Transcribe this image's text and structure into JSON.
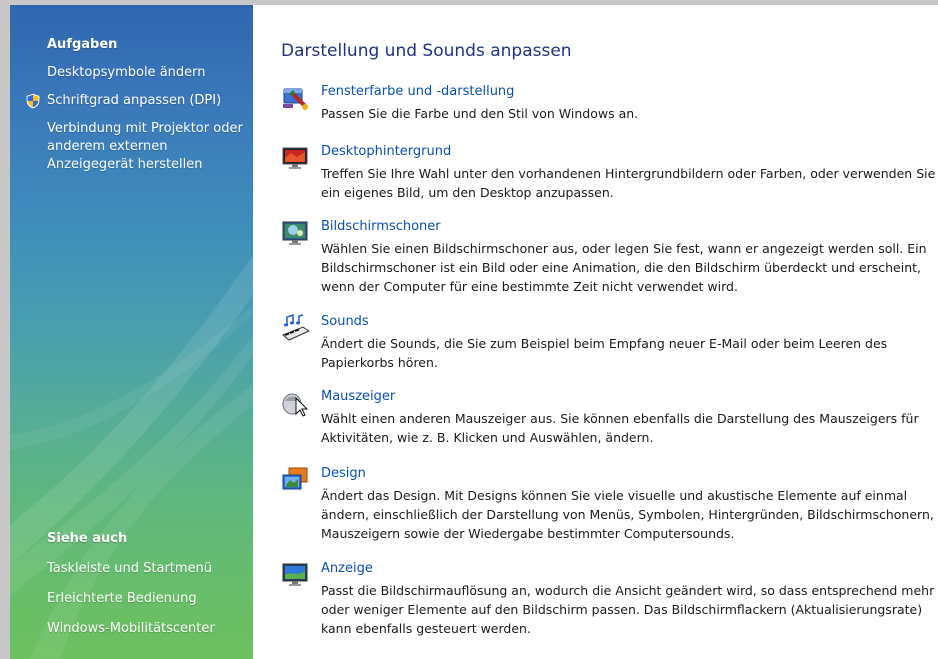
{
  "sidebar": {
    "tasks_heading": "Aufgaben",
    "tasks": [
      {
        "label": "Desktopsymbole ändern",
        "icon": null
      },
      {
        "label": "Schriftgrad anpassen (DPI)",
        "icon": "shield-icon"
      },
      {
        "label": "Verbindung mit Projektor oder anderem externen Anzeigegerät herstellen",
        "icon": null
      }
    ],
    "see_also_heading": "Siehe auch",
    "see_also": [
      {
        "label": "Taskleiste und Startmenü"
      },
      {
        "label": "Erleichterte Bedienung"
      },
      {
        "label": "Windows-Mobilitätscenter"
      }
    ]
  },
  "main": {
    "title": "Darstellung und Sounds anpassen",
    "items": [
      {
        "icon": "window-color-icon",
        "title": "Fensterfarbe und -darstellung",
        "description": "Passen Sie die Farbe und den Stil von Windows an."
      },
      {
        "icon": "desktop-background-icon",
        "title": "Desktophintergrund",
        "description": "Treffen Sie Ihre Wahl unter den vorhandenen Hintergrundbildern oder Farben, oder verwenden Sie ein eigenes Bild, um den Desktop anzupassen."
      },
      {
        "icon": "screensaver-icon",
        "title": "Bildschirmschoner",
        "description": "Wählen Sie einen Bildschirmschoner aus, oder legen Sie fest, wann er angezeigt werden soll. Ein Bildschirmschoner ist ein Bild oder eine Animation, die den Bildschirm überdeckt und erscheint, wenn der Computer für eine bestimmte Zeit nicht verwendet wird."
      },
      {
        "icon": "sounds-icon",
        "title": "Sounds",
        "description": "Ändert die Sounds, die Sie zum Beispiel beim Empfang neuer E-Mail oder beim Leeren des Papierkorbs hören."
      },
      {
        "icon": "mouse-pointer-icon",
        "title": "Mauszeiger",
        "description": "Wählt einen anderen Mauszeiger aus. Sie können ebenfalls die Darstellung des Mauszeigers für Aktivitäten, wie z. B. Klicken und Auswählen, ändern."
      },
      {
        "icon": "theme-icon",
        "title": "Design",
        "description": "Ändert das Design. Mit Designs können Sie viele visuelle und akustische Elemente auf einmal ändern, einschließlich der Darstellung von Menüs, Symbolen, Hintergründen, Bildschirmschonern, Mauszeigern sowie der Wiedergabe bestimmter Computersounds."
      },
      {
        "icon": "display-icon",
        "title": "Anzeige",
        "description": "Passt die Bildschirmauflösung an, wodurch die Ansicht geändert wird, so dass entsprechend mehr oder weniger Elemente auf den Bildschirm passen. Das Bildschirmflackern (Aktualisierungsrate) kann ebenfalls gesteuert werden."
      }
    ]
  },
  "colors": {
    "link": "#0a4fb4",
    "title": "#1e3287",
    "sidebar_top": "#2f66b0",
    "sidebar_bottom": "#6cc05f"
  }
}
